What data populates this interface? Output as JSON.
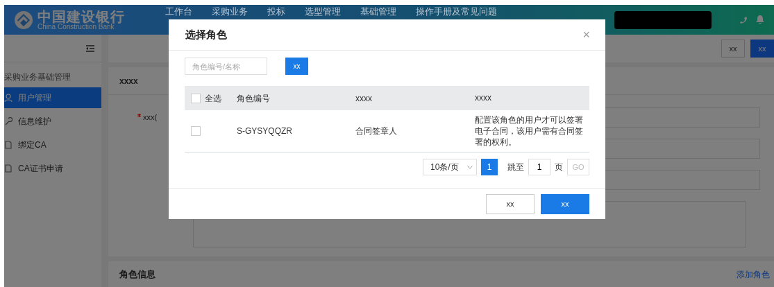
{
  "header": {
    "logo_title": "中国建设银行",
    "logo_subtitle": "China Construction Bank",
    "nav": [
      {
        "label": "工作台"
      },
      {
        "label": "采购业务"
      },
      {
        "label": "投标"
      },
      {
        "label": "选型管理"
      },
      {
        "label": "基础管理"
      },
      {
        "label": "操作手册及常见问题"
      }
    ]
  },
  "sidebar": {
    "section_title": "采购业务基础管理",
    "items": [
      {
        "label": "用户管理",
        "selected": true,
        "kind": "user"
      },
      {
        "label": "信息维护",
        "selected": false,
        "kind": "wrench"
      },
      {
        "label": "绑定CA",
        "selected": false,
        "kind": "doc"
      },
      {
        "label": "CA证书申请",
        "selected": false,
        "kind": "doc"
      }
    ]
  },
  "toolbar": {
    "buttons": [
      {
        "label": "xx",
        "kind": "default"
      },
      {
        "label": "xx",
        "kind": "primary"
      }
    ]
  },
  "panel": {
    "title": "xxxx",
    "field_label": "xxx(",
    "required": true
  },
  "role_panel": {
    "title": "角色信息",
    "add_link": "添加角色"
  },
  "modal": {
    "title": "选择角色",
    "close": "×",
    "search": {
      "placeholder": "角色编号/名称"
    },
    "search_button": "xx",
    "table": {
      "select_all_label": "全选",
      "select_all_checked": false,
      "columns": [
        "角色编号",
        "xxxx",
        "xxxx"
      ],
      "rows": [
        {
          "checked": false,
          "code": "S-GYSYQQZR",
          "name": "合同签章人",
          "description": "配置该角色的用户才可以签署电子合同，该用户需有合同签署的权利。"
        }
      ]
    },
    "pagination": {
      "page_size": "10条/页",
      "pages": [
        {
          "label": "1",
          "selected": true
        }
      ],
      "jump_label": "跳至",
      "jump_value": "1",
      "page_unit": "页",
      "go_label": "GO",
      "go_disabled": true
    },
    "buttons": [
      {
        "label": "xx",
        "kind": "default"
      },
      {
        "label": "xx",
        "kind": "primary"
      }
    ]
  }
}
